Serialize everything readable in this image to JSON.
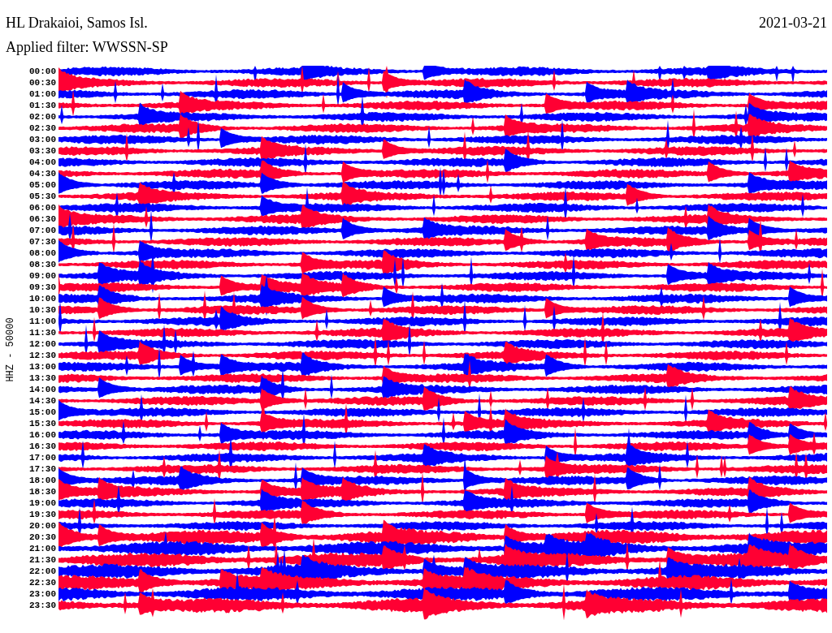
{
  "header": {
    "title": "HL Drakaioi, Samos Isl.",
    "filter": "Applied filter: WWSSN-SP",
    "date": "2021-03-21"
  },
  "axis_label": "HHZ - 50000",
  "rows": [
    {
      "time": "00:00",
      "color": "#0000ff"
    },
    {
      "time": "00:30",
      "color": "#ff0033"
    },
    {
      "time": "01:00",
      "color": "#0000ff"
    },
    {
      "time": "01:30",
      "color": "#ff0033"
    },
    {
      "time": "02:00",
      "color": "#0000ff"
    },
    {
      "time": "02:30",
      "color": "#ff0033"
    },
    {
      "time": "03:00",
      "color": "#0000ff"
    },
    {
      "time": "03:30",
      "color": "#ff0033"
    },
    {
      "time": "04:00",
      "color": "#0000ff"
    },
    {
      "time": "04:30",
      "color": "#ff0033"
    },
    {
      "time": "05:00",
      "color": "#0000ff"
    },
    {
      "time": "05:30",
      "color": "#ff0033"
    },
    {
      "time": "06:00",
      "color": "#0000ff"
    },
    {
      "time": "06:30",
      "color": "#ff0033"
    },
    {
      "time": "07:00",
      "color": "#0000ff"
    },
    {
      "time": "07:30",
      "color": "#ff0033"
    },
    {
      "time": "08:00",
      "color": "#0000ff"
    },
    {
      "time": "08:30",
      "color": "#ff0033"
    },
    {
      "time": "09:00",
      "color": "#0000ff"
    },
    {
      "time": "09:30",
      "color": "#ff0033"
    },
    {
      "time": "10:00",
      "color": "#0000ff"
    },
    {
      "time": "10:30",
      "color": "#ff0033"
    },
    {
      "time": "11:00",
      "color": "#0000ff"
    },
    {
      "time": "11:30",
      "color": "#ff0033"
    },
    {
      "time": "12:00",
      "color": "#0000ff"
    },
    {
      "time": "12:30",
      "color": "#ff0033"
    },
    {
      "time": "13:00",
      "color": "#0000ff"
    },
    {
      "time": "13:30",
      "color": "#ff0033"
    },
    {
      "time": "14:00",
      "color": "#0000ff"
    },
    {
      "time": "14:30",
      "color": "#ff0033"
    },
    {
      "time": "15:00",
      "color": "#0000ff"
    },
    {
      "time": "15:30",
      "color": "#ff0033"
    },
    {
      "time": "16:00",
      "color": "#0000ff"
    },
    {
      "time": "16:30",
      "color": "#ff0033"
    },
    {
      "time": "17:00",
      "color": "#0000ff"
    },
    {
      "time": "17:30",
      "color": "#ff0033"
    },
    {
      "time": "18:00",
      "color": "#0000ff"
    },
    {
      "time": "18:30",
      "color": "#ff0033"
    },
    {
      "time": "19:00",
      "color": "#0000ff"
    },
    {
      "time": "19:30",
      "color": "#ff0033"
    },
    {
      "time": "20:00",
      "color": "#0000ff"
    },
    {
      "time": "20:30",
      "color": "#ff0033"
    },
    {
      "time": "21:00",
      "color": "#0000ff"
    },
    {
      "time": "21:30",
      "color": "#ff0033"
    },
    {
      "time": "22:00",
      "color": "#0000ff"
    },
    {
      "time": "22:30",
      "color": "#ff0033"
    },
    {
      "time": "23:00",
      "color": "#0000ff"
    },
    {
      "time": "23:30",
      "color": "#ff0033"
    }
  ]
}
